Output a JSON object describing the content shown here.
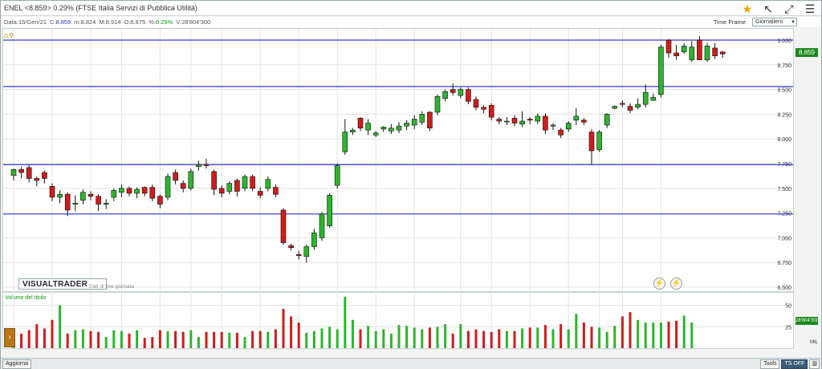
{
  "titlebar": {
    "symbol": "ENEL",
    "price_text": "<8.859>",
    "change_text": "0.29%",
    "index_name": "(FTSE Italia Servizi di Pubblica Utilità)"
  },
  "icons": [
    "star-icon",
    "arrow-up-left-icon",
    "expand-icon",
    "menu-icon"
  ],
  "infobar": {
    "date_label": "Data:",
    "date": "15/Gen/21",
    "close_label": "C:",
    "close": "8.859",
    "min_label": "m:",
    "min": "8.824",
    "max_label": "M:",
    "max": "8.914",
    "open_label": "O:",
    "open": "8.875",
    "pct_label": "%:",
    "pct": "0.29%",
    "vol_label": "V:",
    "vol": "28'804'300"
  },
  "timeframe": {
    "label": "Time Frame",
    "value": "Giornaliero"
  },
  "watermark": {
    "brand": "VISUALTRADER",
    "note": "Dati di fine giornata"
  },
  "volume_label": "Volume del titolo",
  "price_badge": "8.859",
  "volume_badge": "28'804'300",
  "volume_unit": "MIL",
  "bottombar": {
    "aggiorna": "Aggiorna",
    "tools": "Tools",
    "ts_off": "TS OFF"
  },
  "colors": {
    "up": "#2db52d",
    "down": "#d01c1c",
    "hline": "#3a3ad0",
    "grid": "#e3e3e3"
  },
  "chart_data": {
    "type": "candlestick",
    "price_axis": {
      "min": 6.5,
      "max": 9.0,
      "ticks": [
        "9.000",
        "8.750",
        "8.500",
        "8.250",
        "8.000",
        "7.750",
        "7.500",
        "7.250",
        "7.000",
        "6.750",
        "6.500"
      ]
    },
    "volume_axis": {
      "ticks": [
        "50",
        "25"
      ]
    },
    "x_ticks": [
      {
        "label": "14",
        "i": 0
      },
      {
        "label": "21",
        "i": 5
      },
      {
        "label": "28",
        "i": 10
      },
      {
        "label": "Ott",
        "i": 14,
        "color": "#1a44b0"
      },
      {
        "label": "7",
        "i": 19
      },
      {
        "label": "13",
        "i": 23
      },
      {
        "label": "19",
        "i": 27
      },
      {
        "label": "26",
        "i": 32
      },
      {
        "label": "Nov",
        "i": 37,
        "color": "#1a44b0"
      },
      {
        "label": "9",
        "i": 42
      },
      {
        "label": "16",
        "i": 47
      },
      {
        "label": "23",
        "i": 52
      },
      {
        "label": "Dic",
        "i": 58,
        "color": "#1a44b0"
      },
      {
        "label": "7",
        "i": 62
      },
      {
        "label": "14",
        "i": 67
      },
      {
        "label": "21",
        "i": 72
      },
      {
        "label": "28",
        "i": 76
      },
      {
        "label": "21",
        "i": 79,
        "color": "#d01c1c"
      },
      {
        "label": "11",
        "i": 84
      }
    ],
    "hlines": [
      9.0,
      8.53,
      7.74,
      7.24
    ],
    "candles": [
      [
        7.63,
        7.69,
        7.58,
        7.7
      ],
      [
        7.69,
        7.66,
        7.6,
        7.72
      ],
      [
        7.71,
        7.6,
        7.56,
        7.74
      ],
      [
        7.6,
        7.58,
        7.52,
        7.62
      ],
      [
        7.66,
        7.6,
        7.55,
        7.68
      ],
      [
        7.52,
        7.41,
        7.37,
        7.55
      ],
      [
        7.41,
        7.44,
        7.35,
        7.48
      ],
      [
        7.44,
        7.28,
        7.22,
        7.46
      ],
      [
        7.34,
        7.35,
        7.27,
        7.43
      ],
      [
        7.38,
        7.46,
        7.34,
        7.49
      ],
      [
        7.44,
        7.42,
        7.38,
        7.47
      ],
      [
        7.42,
        7.34,
        7.27,
        7.44
      ],
      [
        7.34,
        7.35,
        7.29,
        7.39
      ],
      [
        7.41,
        7.48,
        7.37,
        7.5
      ],
      [
        7.46,
        7.5,
        7.41,
        7.54
      ],
      [
        7.5,
        7.45,
        7.42,
        7.52
      ],
      [
        7.45,
        7.49,
        7.4,
        7.51
      ],
      [
        7.51,
        7.45,
        7.42,
        7.52
      ],
      [
        7.51,
        7.4,
        7.37,
        7.54
      ],
      [
        7.42,
        7.34,
        7.3,
        7.44
      ],
      [
        7.41,
        7.62,
        7.38,
        7.65
      ],
      [
        7.66,
        7.58,
        7.54,
        7.69
      ],
      [
        7.55,
        7.5,
        7.46,
        7.58
      ],
      [
        7.5,
        7.67,
        7.48,
        7.7
      ],
      [
        7.72,
        7.74,
        7.68,
        7.78
      ],
      [
        7.74,
        7.73,
        7.7,
        7.8
      ],
      [
        7.67,
        7.49,
        7.43,
        7.69
      ],
      [
        7.5,
        7.45,
        7.41,
        7.53
      ],
      [
        7.47,
        7.55,
        7.44,
        7.57
      ],
      [
        7.58,
        7.47,
        7.42,
        7.6
      ],
      [
        7.5,
        7.62,
        7.47,
        7.64
      ],
      [
        7.62,
        7.5,
        7.47,
        7.64
      ],
      [
        7.47,
        7.43,
        7.4,
        7.51
      ],
      [
        7.5,
        7.59,
        7.47,
        7.62
      ],
      [
        7.51,
        7.44,
        7.41,
        7.54
      ],
      [
        7.28,
        6.95,
        6.93,
        7.3
      ],
      [
        6.92,
        6.9,
        6.87,
        6.94
      ],
      [
        6.83,
        6.82,
        6.78,
        6.87
      ],
      [
        6.81,
        6.91,
        6.75,
        6.93
      ],
      [
        6.91,
        7.05,
        6.88,
        7.09
      ],
      [
        7.0,
        7.24,
        6.97,
        7.26
      ],
      [
        7.12,
        7.43,
        7.1,
        7.45
      ],
      [
        7.53,
        7.73,
        7.5,
        7.75
      ],
      [
        7.87,
        8.07,
        7.84,
        8.2
      ],
      [
        8.07,
        8.09,
        8.04,
        8.11
      ],
      [
        8.21,
        8.11,
        8.08,
        8.22
      ],
      [
        8.09,
        8.16,
        8.04,
        8.2
      ],
      [
        8.04,
        8.06,
        8.02,
        8.08
      ],
      [
        8.1,
        8.12,
        8.07,
        8.13
      ],
      [
        8.08,
        8.11,
        8.05,
        8.15
      ],
      [
        8.09,
        8.13,
        8.06,
        8.17
      ],
      [
        8.13,
        8.16,
        8.09,
        8.19
      ],
      [
        8.14,
        8.2,
        8.1,
        8.24
      ],
      [
        8.17,
        8.25,
        8.14,
        8.28
      ],
      [
        8.27,
        8.11,
        8.08,
        8.28
      ],
      [
        8.27,
        8.43,
        8.24,
        8.45
      ],
      [
        8.41,
        8.48,
        8.38,
        8.5
      ],
      [
        8.5,
        8.47,
        8.44,
        8.56
      ],
      [
        8.44,
        8.5,
        8.41,
        8.52
      ],
      [
        8.5,
        8.38,
        8.35,
        8.52
      ],
      [
        8.4,
        8.32,
        8.29,
        8.43
      ],
      [
        8.32,
        8.3,
        8.26,
        8.34
      ],
      [
        8.34,
        8.22,
        8.19,
        8.36
      ],
      [
        8.2,
        8.18,
        8.15,
        8.22
      ],
      [
        8.18,
        8.18,
        8.14,
        8.22
      ],
      [
        8.21,
        8.16,
        8.13,
        8.24
      ],
      [
        8.15,
        8.18,
        8.12,
        8.28
      ],
      [
        8.2,
        8.19,
        8.15,
        8.22
      ],
      [
        8.18,
        8.23,
        8.15,
        8.26
      ],
      [
        8.23,
        8.09,
        8.05,
        8.26
      ],
      [
        8.13,
        8.14,
        8.09,
        8.16
      ],
      [
        8.09,
        8.04,
        8.01,
        8.11
      ],
      [
        8.1,
        8.16,
        8.07,
        8.18
      ],
      [
        8.19,
        8.23,
        8.14,
        8.31
      ],
      [
        8.19,
        8.17,
        8.14,
        8.21
      ],
      [
        8.07,
        7.88,
        7.74,
        8.1
      ],
      [
        7.89,
        8.07,
        7.87,
        8.09
      ],
      [
        8.14,
        8.25,
        8.11,
        8.26
      ],
      [
        8.31,
        8.33,
        8.3,
        8.34
      ],
      [
        8.36,
        8.35,
        8.32,
        8.39
      ],
      [
        8.33,
        8.29,
        8.26,
        8.36
      ],
      [
        8.32,
        8.35,
        8.3,
        8.41
      ],
      [
        8.35,
        8.47,
        8.32,
        8.55
      ],
      [
        8.39,
        8.42,
        8.39,
        8.46
      ],
      [
        8.45,
        8.93,
        8.42,
        8.95
      ],
      [
        9.0,
        8.87,
        8.82,
        9.01
      ],
      [
        8.87,
        8.84,
        8.8,
        8.95
      ],
      [
        8.88,
        8.94,
        8.86,
        8.97
      ],
      [
        8.8,
        8.93,
        8.78,
        8.99
      ],
      [
        9.0,
        8.8,
        8.8,
        9.04
      ],
      [
        8.8,
        8.94,
        8.78,
        8.97
      ],
      [
        8.92,
        8.84,
        8.81,
        8.97
      ],
      [
        8.88,
        8.86,
        8.82,
        8.89
      ]
    ],
    "volume": [
      16,
      17,
      21,
      28,
      23,
      33,
      50,
      17,
      21,
      22,
      20,
      19,
      13,
      21,
      20,
      17,
      21,
      12,
      13,
      21,
      20,
      20,
      19,
      21,
      13,
      19,
      19,
      19,
      18,
      18,
      13,
      20,
      20,
      19,
      22,
      46,
      37,
      30,
      18,
      20,
      23,
      25,
      22,
      60,
      33,
      22,
      26,
      20,
      22,
      17,
      27,
      26,
      24,
      22,
      24,
      25,
      28,
      17,
      28,
      20,
      22,
      20,
      19,
      22,
      20,
      20,
      23,
      24,
      24,
      27,
      22,
      28,
      22,
      40,
      30,
      25,
      24,
      19,
      26,
      37,
      42,
      33,
      30,
      30,
      30,
      31,
      32,
      38,
      30
    ]
  }
}
